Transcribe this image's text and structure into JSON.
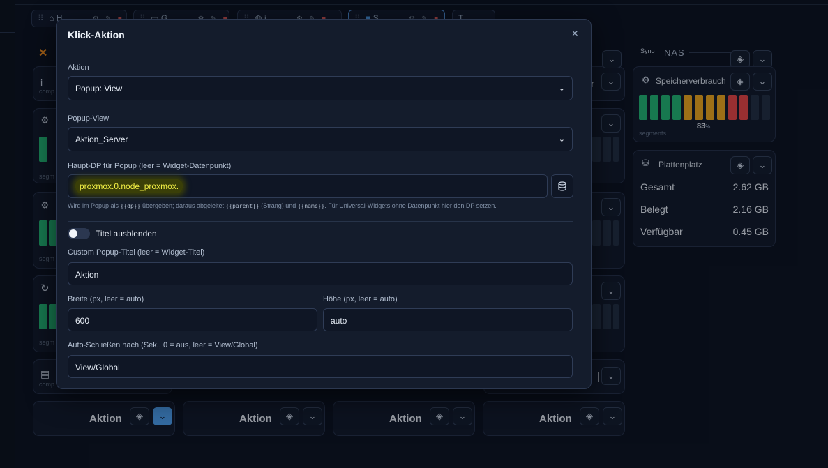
{
  "background": {
    "tabs": [
      {
        "label": "H",
        "icon": "home-icon",
        "active": false
      },
      {
        "label": "G",
        "icon": "monitor-icon",
        "active": false
      },
      {
        "label": "i",
        "icon": "globe-icon",
        "active": false
      },
      {
        "label": "S",
        "icon": "server-icon",
        "active": true
      },
      {
        "label": "T",
        "icon": "",
        "active": false
      }
    ],
    "col1_labels": {
      "comp": "comp",
      "segm1": "segm",
      "segm2": "segm",
      "segm3": "segm",
      "comp2": "comp"
    },
    "aktion_cards": [
      {
        "label": "Aktion"
      },
      {
        "label": "Aktion"
      },
      {
        "label": "Aktion"
      },
      {
        "label": "Aktion"
      }
    ],
    "nas": {
      "section_title": "NAS",
      "section_sub": "Syno",
      "memory": {
        "title": "Speicherverbrauch",
        "percent": 83,
        "percent_text": "83",
        "percent_unit": "%",
        "label": "segments",
        "segments": [
          "g",
          "g",
          "g",
          "g",
          "o",
          "o",
          "o",
          "o",
          "r",
          "r",
          "d",
          "d"
        ]
      },
      "disk": {
        "title": "Plattenplatz",
        "rows": [
          {
            "label": "Gesamt",
            "value": "2.62 GB"
          },
          {
            "label": "Belegt",
            "value": "2.16 GB"
          },
          {
            "label": "Verfügbar",
            "value": "0.45 GB"
          }
        ]
      }
    },
    "partial_text": {
      "r": "r",
      "bar": "|"
    }
  },
  "modal": {
    "title": "Klick-Aktion",
    "close_symbol": "×",
    "aktion": {
      "label": "Aktion",
      "value": "Popup: View"
    },
    "popup_view": {
      "label": "Popup-View",
      "value": "Aktion_Server"
    },
    "haupt_dp": {
      "label": "Haupt-DP für Popup (leer = Widget-Datenpunkt)",
      "value": "proxmox.0.node_proxmox."
    },
    "hint": {
      "part1": "Wird im Popup als ",
      "code1": "{{dp}}",
      "part2": " übergeben; daraus abgeleitet ",
      "code2": "{{parent}}",
      "part3": " (Strang) und ",
      "code3": "{{name}}",
      "part4": ". Für Universal-Widgets ohne Datenpunkt hier den DP setzen."
    },
    "titel_ausblenden": {
      "label": "Titel ausblenden",
      "checked": false
    },
    "custom_title": {
      "label": "Custom Popup-Titel (leer = Widget-Titel)",
      "value": "Aktion"
    },
    "breite": {
      "label": "Breite (px, leer = auto)",
      "value": "600"
    },
    "hoehe": {
      "label": "Höhe (px, leer = auto)",
      "value": "auto"
    },
    "auto_close": {
      "label": "Auto-Schließen nach (Sek., 0 = aus, leer = View/Global)",
      "value": "View/Global"
    }
  },
  "colors": {
    "accent": "#4ea0f0",
    "green": "#22b573",
    "orange": "#f0a81e",
    "red": "#e84545",
    "highlight": "#f2ef45"
  }
}
